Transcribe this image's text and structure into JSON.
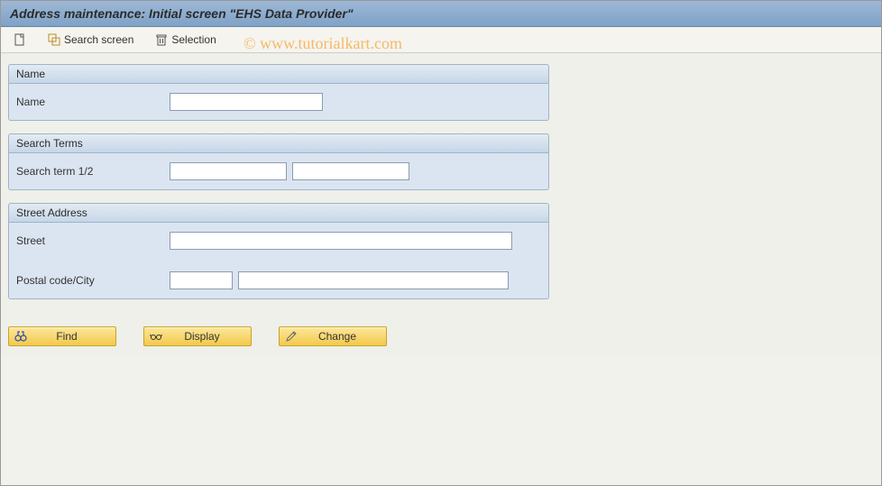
{
  "title": "Address maintenance: Initial screen \"EHS Data Provider\"",
  "toolbar": {
    "create_label": "",
    "search_screen_label": "Search screen",
    "selection_label": "Selection"
  },
  "groups": {
    "name": {
      "header": "Name",
      "field_label": "Name",
      "value": ""
    },
    "search_terms": {
      "header": "Search Terms",
      "field_label": "Search term 1/2",
      "value1": "",
      "value2": ""
    },
    "street_address": {
      "header": "Street Address",
      "street_label": "Street",
      "street_value": "",
      "postal_city_label": "Postal code/City",
      "postal_value": "",
      "city_value": ""
    }
  },
  "buttons": {
    "find": "Find",
    "display": "Display",
    "change": "Change"
  },
  "watermark": "©  www.tutorialkart.com"
}
